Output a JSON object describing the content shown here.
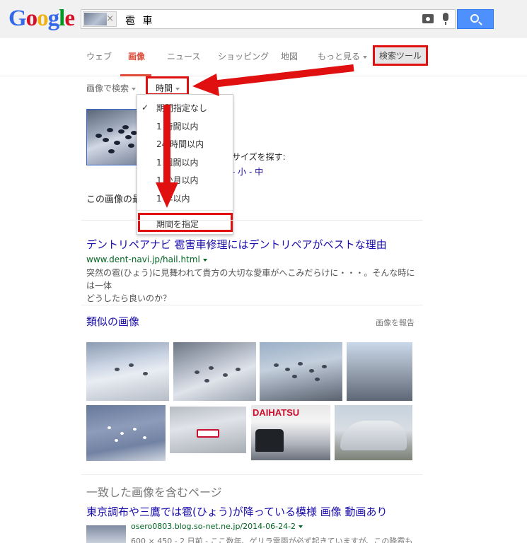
{
  "logo": {
    "letters": [
      "G",
      "o",
      "o",
      "g",
      "l",
      "e"
    ],
    "colors": [
      "#3369e8",
      "#d50f25",
      "#eeb211",
      "#3369e8",
      "#009925",
      "#d50f25"
    ]
  },
  "search": {
    "query": "雹 車",
    "thumb_close": "×"
  },
  "tabs": [
    {
      "label": "ウェブ"
    },
    {
      "label": "画像"
    },
    {
      "label": "ニュース"
    },
    {
      "label": "ショッピング"
    },
    {
      "label": "地図"
    },
    {
      "label": "もっと見る"
    }
  ],
  "search_tools": "検索ツール",
  "toolbar": {
    "search_by_image": "画像で検索",
    "time": "時間"
  },
  "time_menu": {
    "checked_mark": "✓",
    "items": [
      "期間指定なし",
      "1 時間以内",
      "24 時間以内",
      "1 週間以内",
      "1 か月以内",
      "1 年以内"
    ],
    "custom": "期間を指定"
  },
  "image_info": {
    "size_label": "サイズを探す:",
    "size_links": "- 小 - 中",
    "best_guess": "この画像の最"
  },
  "result1": {
    "title": "デントリペアナビ 雹害車修理にはデントリペアがベストな理由",
    "url": "www.dent-navi.jp/hail.html",
    "snippet_line1": "突然の雹(ひょう)に見舞われて貴方の大切な愛車がへこみだらけに・・・。そんな時には一体",
    "snippet_line2": "どうしたら良いのか？"
  },
  "similar": {
    "title": "類似の画像",
    "report": "画像を報告",
    "dealer_logo": "DAIHATSU"
  },
  "matching": {
    "title": "一致した画像を含むページ",
    "result_title": "東京調布や三鷹では雹(ひょう)が降っている模様 画像 動画あり",
    "result_url": "osero0803.blog.so-net.ne.jp/2014-06-24-2",
    "result_meta": "600 × 450 - 2 日前 - ここ数年、ゲリラ雷雨が必ず起きていますが、この降雹も"
  },
  "annotation_color": "#e01010"
}
